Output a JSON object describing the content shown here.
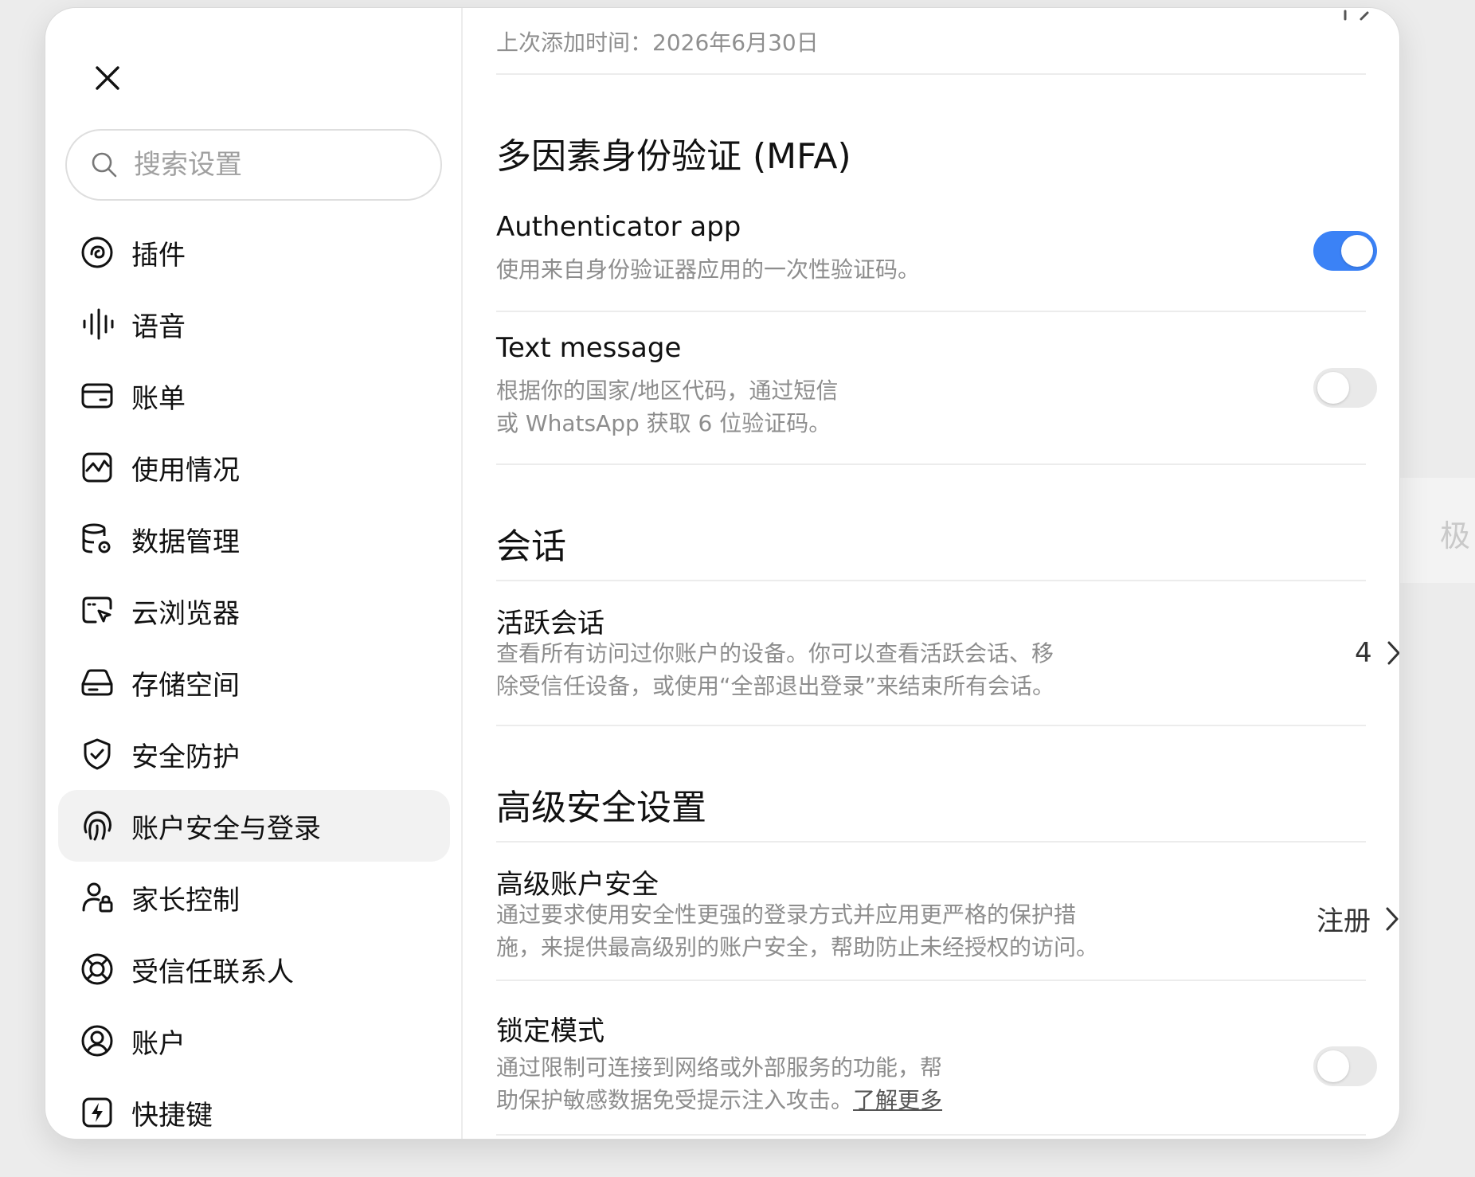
{
  "background": {
    "partial_text": "极"
  },
  "sidebar": {
    "search_placeholder": "搜索设置",
    "items": [
      {
        "label": "插件",
        "icon": "plugin-icon"
      },
      {
        "label": "语音",
        "icon": "voice-waveform-icon"
      },
      {
        "label": "账单",
        "icon": "card-icon"
      },
      {
        "label": "使用情况",
        "icon": "usage-chart-icon"
      },
      {
        "label": "数据管理",
        "icon": "database-settings-icon"
      },
      {
        "label": "云浏览器",
        "icon": "cloud-browser-icon"
      },
      {
        "label": "存储空间",
        "icon": "storage-drive-icon"
      },
      {
        "label": "安全防护",
        "icon": "shield-check-icon"
      },
      {
        "label": "账户安全与登录",
        "icon": "fingerprint-icon",
        "active": true
      },
      {
        "label": "家长控制",
        "icon": "parent-lock-icon"
      },
      {
        "label": "受信任联系人",
        "icon": "lifebuoy-icon"
      },
      {
        "label": "账户",
        "icon": "account-circle-icon"
      },
      {
        "label": "快捷键",
        "icon": "shortcut-bolt-icon"
      }
    ]
  },
  "content": {
    "last_added": "上次添加时间：2026年6月30日",
    "mfa": {
      "title": "多因素身份验证 (MFA)",
      "authenticator": {
        "title": "Authenticator app",
        "desc": "使用来自身份验证器应用的一次性验证码。",
        "enabled": true
      },
      "text_message": {
        "title": "Text message",
        "desc_line1": "根据你的国家/地区代码，通过短信",
        "desc_line2": "或 WhatsApp 获取 6 位验证码。",
        "enabled": false
      }
    },
    "sessions": {
      "title": "会话",
      "active": {
        "title": "活跃会话",
        "desc_line1": "查看所有访问过你账户的设备。你可以查看活跃会话、移",
        "desc_line2": "除受信任设备，或使用“全部退出登录”来结束所有会话。",
        "count": "4"
      }
    },
    "advanced": {
      "title": "高级安全设置",
      "account_security": {
        "title": "高级账户安全",
        "desc_line1": "通过要求使用安全性更强的登录方式并应用更严格的保护措",
        "desc_line2": "施，来提供最高级别的账户安全，帮助防止未经授权的访问。",
        "action": "注册"
      },
      "lockdown": {
        "title": "锁定模式",
        "desc_line1": "通过限制可连接到网络或外部服务的功能，帮",
        "desc_line2": "助保护敏感数据免受提示注入攻击。",
        "learn_more": "了解更多",
        "enabled": false
      }
    }
  },
  "colors": {
    "accent": "#3b82f6"
  }
}
